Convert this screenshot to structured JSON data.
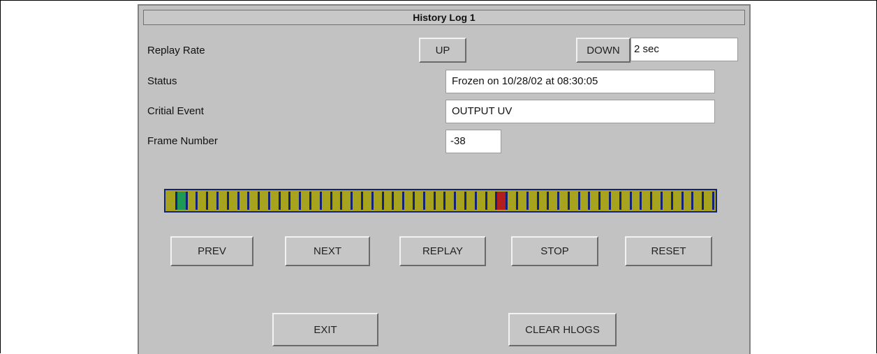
{
  "window": {
    "title": "History Log 1"
  },
  "replay_rate": {
    "label": "Replay Rate",
    "up_label": "UP",
    "down_label": "DOWN",
    "value": "2 sec"
  },
  "status": {
    "label": "Status",
    "value": "Frozen on 10/28/02 at 08:30:05"
  },
  "critical_event": {
    "label": "Critial Event",
    "value": "OUTPUT UV"
  },
  "frame_number": {
    "label": "Frame Number",
    "value": "-38"
  },
  "frame_meter": {
    "segment_count": 53,
    "current_segment": 1,
    "marker_segment": 32,
    "colors": {
      "segment": "#a7a31f",
      "divider": "#142277",
      "current": "#1f9a55",
      "marker": "#b21d1d"
    }
  },
  "controls": {
    "prev": "PREV",
    "next": "NEXT",
    "replay": "REPLAY",
    "stop": "STOP",
    "reset": "RESET"
  },
  "footer": {
    "exit": "EXIT",
    "clear_hlogs": "CLEAR HLOGS"
  }
}
